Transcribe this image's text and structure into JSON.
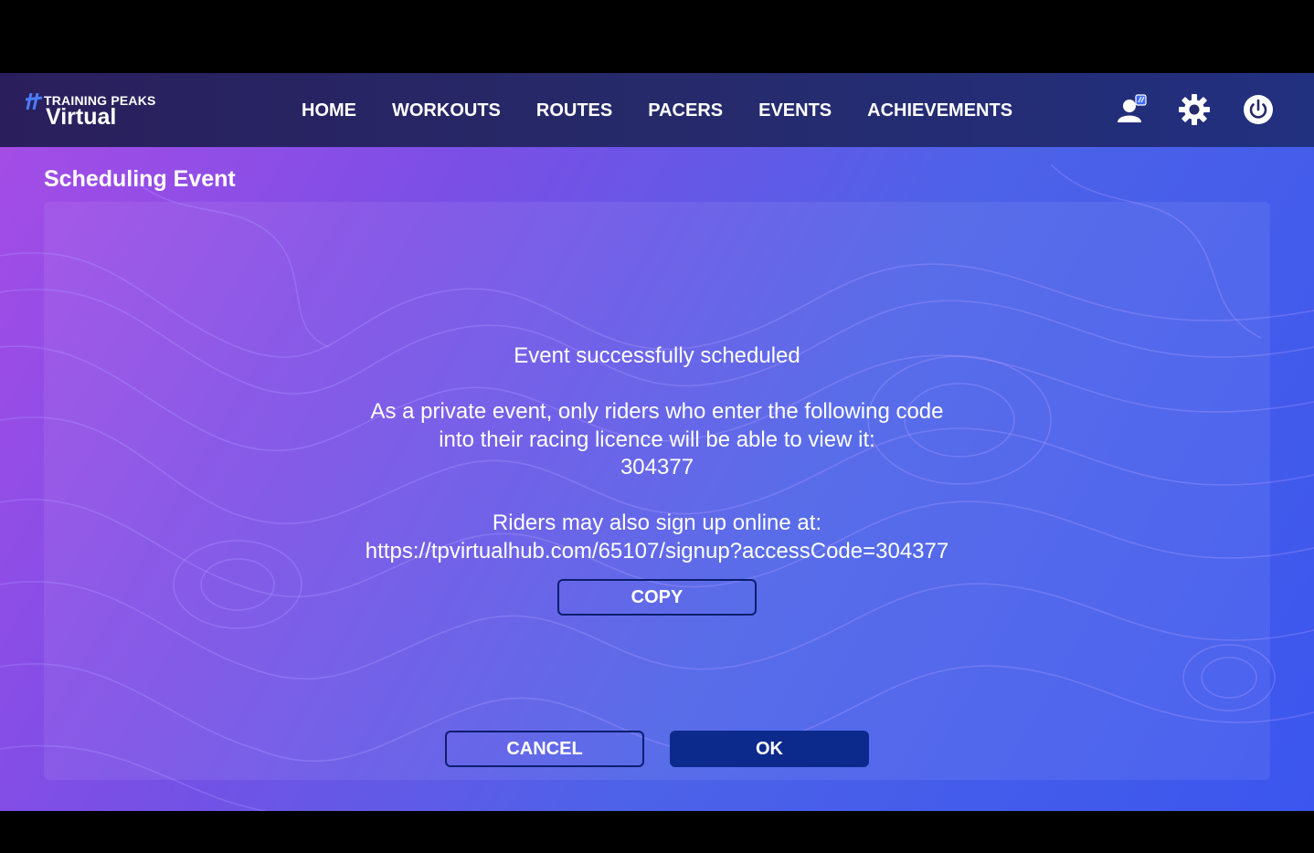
{
  "app": {
    "logo_top": "TRAINING PEAKS",
    "logo_bottom": "Virtual"
  },
  "nav": {
    "items": [
      {
        "label": "HOME"
      },
      {
        "label": "WORKOUTS"
      },
      {
        "label": "ROUTES"
      },
      {
        "label": "PACERS"
      },
      {
        "label": "EVENTS"
      },
      {
        "label": "ACHIEVEMENTS"
      }
    ],
    "icons": [
      "profile-icon",
      "gear-icon",
      "power-icon"
    ]
  },
  "page": {
    "title": "Scheduling Event"
  },
  "dialog": {
    "heading": "Event successfully scheduled",
    "message_line1": "As a private event, only riders who enter the following code",
    "message_line2": "into their racing licence will be able to view it:",
    "code": "304377",
    "signup_text": "Riders may also sign up online at:",
    "signup_url": "https://tpvirtualhub.com/65107/signup?accessCode=304377",
    "copy_label": "COPY",
    "cancel_label": "CANCEL",
    "ok_label": "OK"
  },
  "colors": {
    "navbar": "#262a6a",
    "ok_button": "#0c2a8c",
    "button_border": "#0c1e6e",
    "gradient_start": "#a84ce6",
    "gradient_end": "#3b56ee"
  }
}
